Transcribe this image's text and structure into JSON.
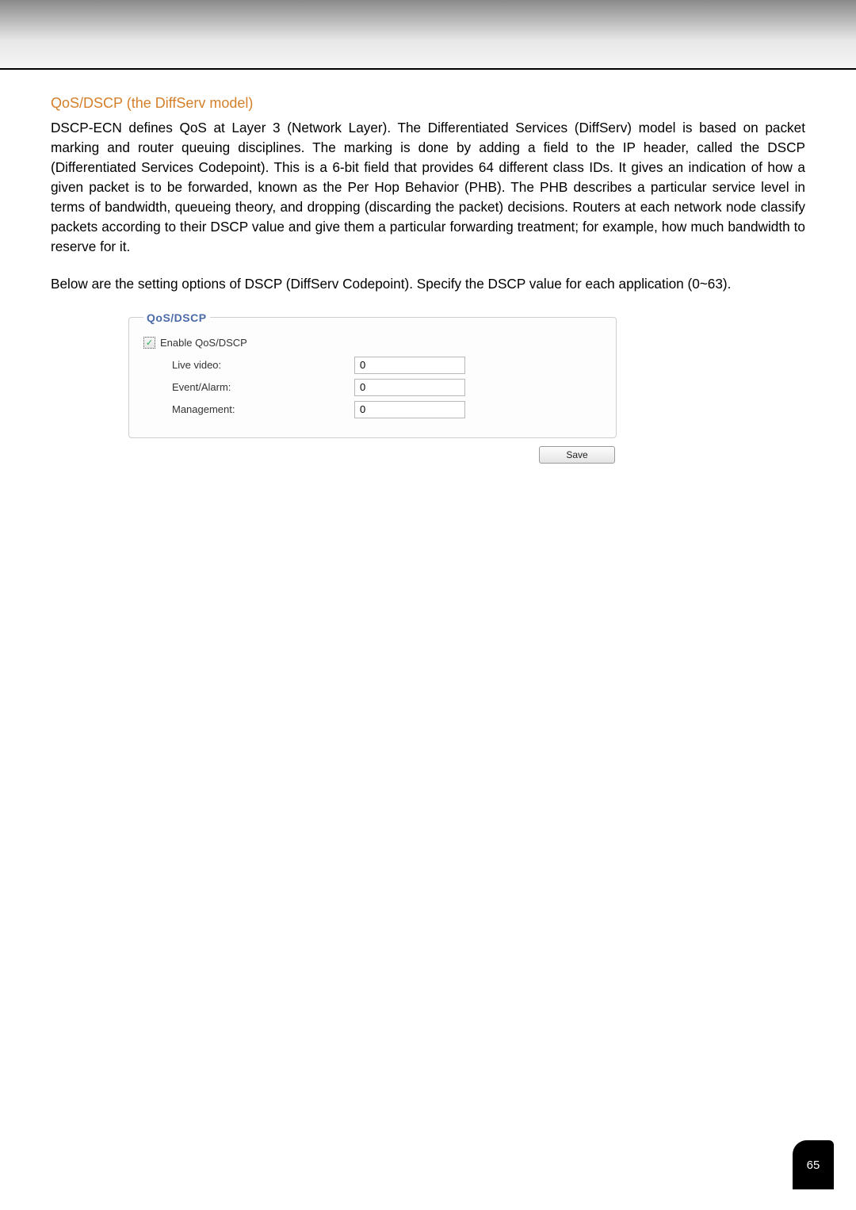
{
  "heading": "QoS/DSCP (the DiffServ model)",
  "paragraph1": "DSCP-ECN defines QoS at Layer 3 (Network Layer). The Differentiated Services (DiffServ) model is based on packet marking and router queuing disciplines. The marking is done by adding a field to the IP header, called the DSCP (Differentiated Services Codepoint). This is a 6-bit field that provides 64 different class IDs. It gives an indication of how a given packet is to be forwarded, known as the Per Hop Behavior (PHB). The PHB describes a particular service level in terms of bandwidth, queueing theory, and dropping (discarding the packet) decisions. Routers at each network node classify packets according to their DSCP value and give them a particular forwarding treatment; for example, how much bandwidth to reserve for it.",
  "paragraph2": "Below are the setting options of DSCP (DiffServ Codepoint). Specify the DSCP value for each application (0~63).",
  "form": {
    "legend": "QoS/DSCP",
    "enable_label": "Enable QoS/DSCP",
    "enable_checked": true,
    "fields": {
      "live_video": {
        "label": "Live video:",
        "value": "0"
      },
      "event_alarm": {
        "label": "Event/Alarm:",
        "value": "0"
      },
      "management": {
        "label": "Management:",
        "value": "0"
      }
    },
    "save_label": "Save"
  },
  "page_number": "65"
}
